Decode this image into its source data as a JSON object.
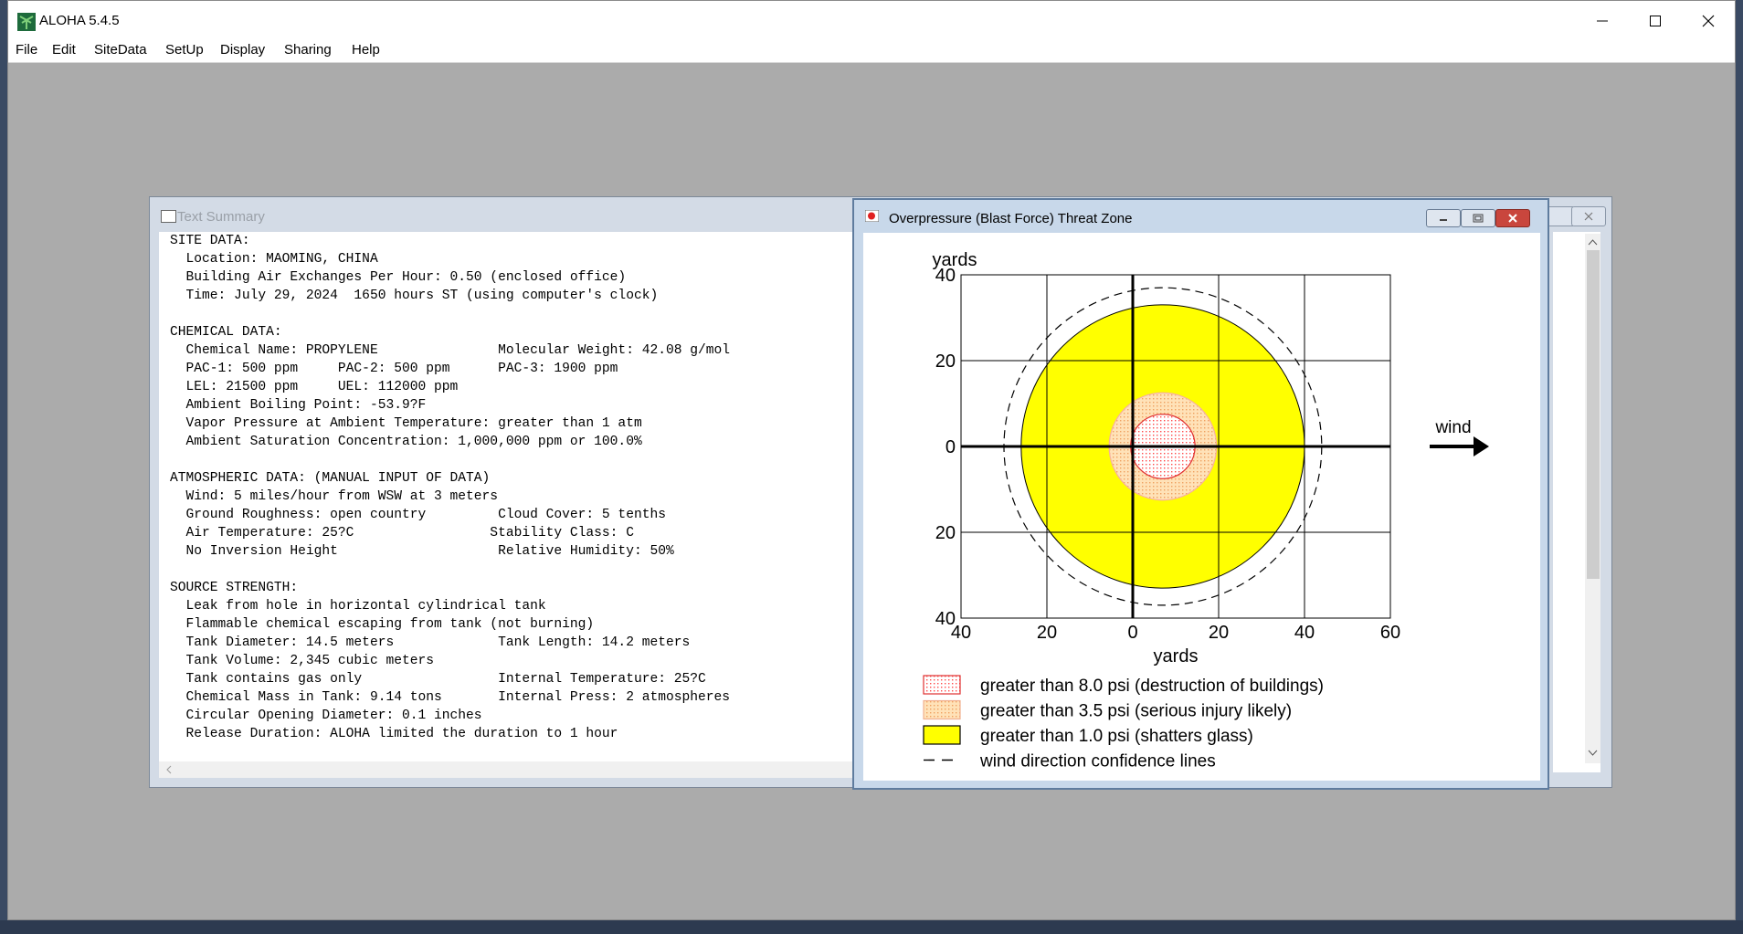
{
  "app": {
    "title": "ALOHA 5.4.5",
    "menu": [
      "File",
      "Edit",
      "SiteData",
      "SetUp",
      "Display",
      "Sharing",
      "Help"
    ]
  },
  "text_summary": {
    "title": "Text Summary",
    "lines": [
      "SITE DATA:",
      "  Location: MAOMING, CHINA",
      "  Building Air Exchanges Per Hour: 0.50 (enclosed office)",
      "  Time: July 29, 2024  1650 hours ST (using computer's clock)",
      "",
      "CHEMICAL DATA:",
      "  Chemical Name: PROPYLENE               Molecular Weight: 42.08 g/mol",
      "  PAC-1: 500 ppm     PAC-2: 500 ppm      PAC-3: 1900 ppm",
      "  LEL: 21500 ppm     UEL: 112000 ppm",
      "  Ambient Boiling Point: -53.9?F",
      "  Vapor Pressure at Ambient Temperature: greater than 1 atm",
      "  Ambient Saturation Concentration: 1,000,000 ppm or 100.0%",
      "",
      "ATMOSPHERIC DATA: (MANUAL INPUT OF DATA)",
      "  Wind: 5 miles/hour from WSW at 3 meters",
      "  Ground Roughness: open country         Cloud Cover: 5 tenths",
      "  Air Temperature: 25?C                 Stability Class: C",
      "  No Inversion Height                    Relative Humidity: 50%",
      "",
      "SOURCE STRENGTH:",
      "  Leak from hole in horizontal cylindrical tank",
      "  Flammable chemical escaping from tank (not burning)",
      "  Tank Diameter: 14.5 meters             Tank Length: 14.2 meters",
      "  Tank Volume: 2,345 cubic meters",
      "  Tank contains gas only                 Internal Temperature: 25?C",
      "  Chemical Mass in Tank: 9.14 tons       Internal Press: 2 atmospheres",
      "  Circular Opening Diameter: 0.1 inches",
      "  Release Duration: ALOHA limited the duration to 1 hour"
    ]
  },
  "threat_zone": {
    "title": "Overpressure (Blast Force) Threat Zone",
    "wind_label": "wind",
    "legend": [
      {
        "label": "greater than 8.0 psi (destruction of buildings)",
        "color": "#ff6a6a",
        "pattern": "red-dots"
      },
      {
        "label": "greater than 3.5 psi (serious injury likely)",
        "color": "#f7c89a",
        "pattern": "orange-dots"
      },
      {
        "label": "greater than 1.0 psi (shatters glass)",
        "color": "#ffff00",
        "pattern": "solid"
      },
      {
        "label": "wind direction confidence lines",
        "color": "#000000",
        "pattern": "dashed-line"
      }
    ]
  },
  "chart_data": {
    "type": "scatter",
    "xlabel": "yards",
    "ylabel": "yards",
    "xlim": [
      -40,
      60
    ],
    "ylim": [
      -40,
      40
    ],
    "x_ticks": [
      "40",
      "20",
      "0",
      "20",
      "40",
      "60"
    ],
    "y_ticks": [
      "40",
      "20",
      "0",
      "20",
      "40"
    ],
    "grid": true,
    "zones": [
      {
        "name": "greater than 1.0 psi (shatters glass)",
        "center_x": 7,
        "center_y": 0,
        "radius": 33,
        "color": "#ffff00"
      },
      {
        "name": "greater than 3.5 psi (serious injury likely)",
        "center_x": 7,
        "center_y": 0,
        "radius": 12.5,
        "color": "#f7c89a"
      },
      {
        "name": "greater than 8.0 psi (destruction of buildings)",
        "center_x": 7,
        "center_y": 0,
        "radius": 7.5,
        "color": "#ff6a6a"
      }
    ],
    "confidence_line": {
      "center_x": 7,
      "center_y": 0,
      "radius": 37
    }
  },
  "icons": {
    "app": "palm-tree-icon",
    "minimize": "minimize-icon",
    "maximize": "maximize-icon",
    "close": "close-icon"
  }
}
